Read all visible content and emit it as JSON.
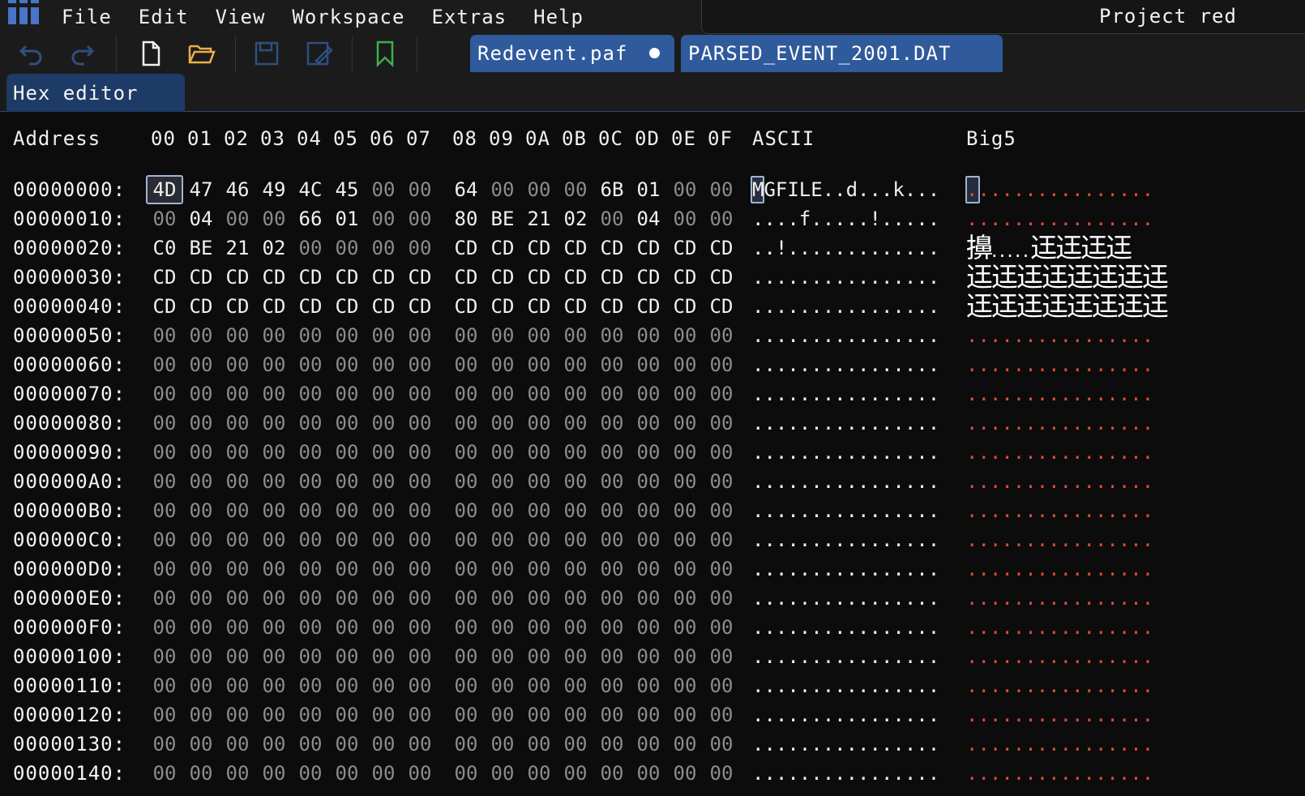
{
  "menu": [
    "File",
    "Edit",
    "View",
    "Workspace",
    "Extras",
    "Help"
  ],
  "project_name": "Project red",
  "toolbar": {
    "undo_icon": "undo-arrow",
    "redo_icon": "redo-arrow",
    "new_icon": "document",
    "open_icon": "folder-open",
    "save_icon": "floppy",
    "save_as_icon": "floppy-pencil",
    "bookmark_icon": "bookmark"
  },
  "file_tabs": [
    {
      "label": "Redevent.paf",
      "modified": true
    },
    {
      "label": "PARSED_EVENT_2001.DAT",
      "modified": false
    }
  ],
  "panel_tab": "Hex editor",
  "hex": {
    "headers": {
      "address": "Address",
      "cols_low": [
        "00",
        "01",
        "02",
        "03",
        "04",
        "05",
        "06",
        "07"
      ],
      "cols_high": [
        "08",
        "09",
        "0A",
        "0B",
        "0C",
        "0D",
        "0E",
        "0F"
      ],
      "ascii": "ASCII",
      "big5": "Big5"
    },
    "rows": [
      {
        "addr": "00000000:",
        "bytes": [
          "4D",
          "47",
          "46",
          "49",
          "4C",
          "45",
          "00",
          "00",
          "64",
          "00",
          "00",
          "00",
          "6B",
          "01",
          "00",
          "00"
        ],
        "ascii": "MGFILE..d...k...",
        "big5": "................"
      },
      {
        "addr": "00000010:",
        "bytes": [
          "00",
          "04",
          "00",
          "00",
          "66",
          "01",
          "00",
          "00",
          "80",
          "BE",
          "21",
          "02",
          "00",
          "04",
          "00",
          "00"
        ],
        "ascii": "....f.....!.....",
        "big5": "................"
      },
      {
        "addr": "00000020:",
        "bytes": [
          "C0",
          "BE",
          "21",
          "02",
          "00",
          "00",
          "00",
          "00",
          "CD",
          "CD",
          "CD",
          "CD",
          "CD",
          "CD",
          "CD",
          "CD"
        ],
        "ascii": "..!.............",
        "big5": "擤.....迋迋迋迋"
      },
      {
        "addr": "00000030:",
        "bytes": [
          "CD",
          "CD",
          "CD",
          "CD",
          "CD",
          "CD",
          "CD",
          "CD",
          "CD",
          "CD",
          "CD",
          "CD",
          "CD",
          "CD",
          "CD",
          "CD"
        ],
        "ascii": "................",
        "big5": "迋迋迋迋迋迋迋迋"
      },
      {
        "addr": "00000040:",
        "bytes": [
          "CD",
          "CD",
          "CD",
          "CD",
          "CD",
          "CD",
          "CD",
          "CD",
          "CD",
          "CD",
          "CD",
          "CD",
          "CD",
          "CD",
          "CD",
          "CD"
        ],
        "ascii": "................",
        "big5": "迋迋迋迋迋迋迋迋"
      },
      {
        "addr": "00000050:",
        "zero": true
      },
      {
        "addr": "00000060:",
        "zero": true
      },
      {
        "addr": "00000070:",
        "zero": true
      },
      {
        "addr": "00000080:",
        "zero": true
      },
      {
        "addr": "00000090:",
        "zero": true
      },
      {
        "addr": "000000A0:",
        "zero": true
      },
      {
        "addr": "000000B0:",
        "zero": true
      },
      {
        "addr": "000000C0:",
        "zero": true
      },
      {
        "addr": "000000D0:",
        "zero": true
      },
      {
        "addr": "000000E0:",
        "zero": true
      },
      {
        "addr": "000000F0:",
        "zero": true
      },
      {
        "addr": "00000100:",
        "zero": true
      },
      {
        "addr": "00000110:",
        "zero": true
      },
      {
        "addr": "00000120:",
        "zero": true
      },
      {
        "addr": "00000130:",
        "zero": true
      },
      {
        "addr": "00000140:",
        "zero": true
      }
    ],
    "zero_row": {
      "bytes": [
        "00",
        "00",
        "00",
        "00",
        "00",
        "00",
        "00",
        "00",
        "00",
        "00",
        "00",
        "00",
        "00",
        "00",
        "00",
        "00"
      ],
      "ascii": "................",
      "big5": "................"
    },
    "cursor_offset": "00000000"
  },
  "colors": {
    "background": "#0c0c0c",
    "tab_active": "#2f5a9c",
    "panel_tab": "#1e3a66",
    "zero_byte": "#8c8c8c",
    "big5_dots": "#e14b3a"
  }
}
